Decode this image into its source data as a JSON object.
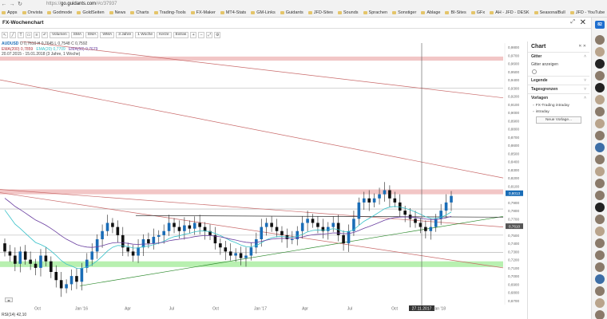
{
  "browser": {
    "url_prefix": "https://",
    "url_host": "go.guidants.com",
    "url_path": "/#c/37937",
    "bookmarks": [
      "Apps",
      "Onvista",
      "Godmode",
      "GoldSeiten",
      "News",
      "Charts",
      "Trading-Tools",
      "FX-Maker",
      "MT4-Stats",
      "GM-Links",
      "Guidants",
      "JFD-Sites",
      "Sounds",
      "Sprachen",
      "Sonstiger",
      "Ablage",
      "BI-Sites",
      "GFx",
      "AH - JFD - DESK",
      "SeasonalBull",
      "JFD - YouTube"
    ]
  },
  "header": {
    "title": "FX-Wochenchart"
  },
  "toolbar": {
    "buttons": [
      "Volumen",
      "SMA",
      "EMA",
      "WMA",
      "3 Jahre",
      "1 Woche",
      "Kerze",
      "Extras"
    ]
  },
  "legend": {
    "symbol": "AUDUSD",
    "ohlc": "O 0,7610  H 0,7645  L 0,7548  C 0,7592",
    "ma200": "EMA(200) 0,7859",
    "ma20": "EMA(20) 0,7709",
    "ma50": "EMA(50) 0,7679",
    "range": "20.07.2015 - 15.01.2018 (3 Jahre, 1 Woche)"
  },
  "chart_data": {
    "type": "candlestick",
    "title": "",
    "x_labels": [
      "Oct",
      "Jan '16",
      "Apr",
      "Jul",
      "Oct",
      "Jan '17",
      "Apr",
      "Jul",
      "Oct",
      "Jan '18"
    ],
    "y_ticks": [
      "0,6700",
      "0,6800",
      "0,6900",
      "0,7000",
      "0,7100",
      "0,7200",
      "0,7300",
      "0,7400",
      "0,7500",
      "0,7600",
      "0,7700",
      "0,7800",
      "0,7900",
      "0,8000",
      "0,8100",
      "0,8200",
      "0,8300",
      "0,8400",
      "0,8500",
      "0,8600",
      "0,8700",
      "0,8800",
      "0,8900",
      "0,9000",
      "0,9100",
      "0,9200",
      "0,9300",
      "0,9400",
      "0,9500",
      "0,9600",
      "0,9700",
      "0,9800"
    ],
    "ylim": [
      0.665,
      0.985
    ],
    "crosshair_date": "27.11.2017",
    "price_tags": [
      {
        "label": "0,8013",
        "value": 0.8013,
        "color": "#1a6db7"
      },
      {
        "label": "0,7610",
        "value": 0.761,
        "color": "#555555"
      }
    ],
    "closes": [
      0.73,
      0.725,
      0.715,
      0.73,
      0.72,
      0.715,
      0.71,
      0.725,
      0.718,
      0.705,
      0.695,
      0.685,
      0.69,
      0.7,
      0.693,
      0.71,
      0.72,
      0.73,
      0.745,
      0.755,
      0.765,
      0.76,
      0.75,
      0.735,
      0.73,
      0.725,
      0.735,
      0.745,
      0.74,
      0.748,
      0.75,
      0.755,
      0.765,
      0.76,
      0.755,
      0.762,
      0.758,
      0.765,
      0.76,
      0.755,
      0.75,
      0.74,
      0.735,
      0.73,
      0.725,
      0.728,
      0.722,
      0.725,
      0.735,
      0.745,
      0.76,
      0.765,
      0.76,
      0.755,
      0.75,
      0.745,
      0.745,
      0.755,
      0.765,
      0.77,
      0.765,
      0.76,
      0.755,
      0.76,
      0.765,
      0.75,
      0.74,
      0.755,
      0.77,
      0.79,
      0.795,
      0.79,
      0.795,
      0.8,
      0.805,
      0.795,
      0.79,
      0.78,
      0.775,
      0.77,
      0.765,
      0.76,
      0.755,
      0.76,
      0.77,
      0.78,
      0.79,
      0.798
    ]
  },
  "panel": {
    "title": "Chart",
    "gitter": "Gitter",
    "gitter_show": "Gitter anzeigen",
    "legende": "Legende",
    "tagesgrenzen": "Tagesgrenzen",
    "vorlagen": "Vorlagen",
    "tmpl1": "FX-Trading intraday",
    "tmpl2": "intraday",
    "new_template": "Neue Vorlage..."
  },
  "rail": {
    "badge": "82"
  },
  "footer": {
    "indicator": "RSI(14) 42,10"
  },
  "colors": {
    "accent": "#1f6fcf",
    "bull": "#1a6db7",
    "bear": "#111111",
    "ma200": "#b2323a",
    "ma20": "#38c1c9",
    "ma50": "#6a3fa0",
    "zone_red": "#f2c6c6",
    "zone_green": "#b8f0b0"
  }
}
